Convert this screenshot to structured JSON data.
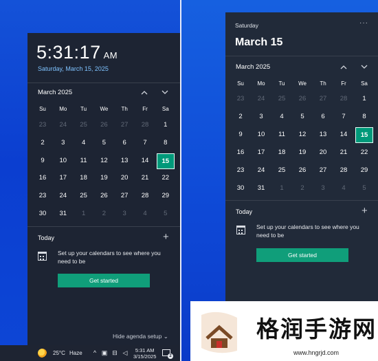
{
  "left_panel": {
    "time": "5:31:17",
    "ampm": "AM",
    "long_date": "Saturday, March 15, 2025",
    "month_label": "March 2025",
    "weekdays": [
      "Su",
      "Mo",
      "Tu",
      "We",
      "Th",
      "Fr",
      "Sa"
    ],
    "weeks": [
      [
        "23",
        "24",
        "25",
        "26",
        "27",
        "28",
        "1"
      ],
      [
        "2",
        "3",
        "4",
        "5",
        "6",
        "7",
        "8"
      ],
      [
        "9",
        "10",
        "11",
        "12",
        "13",
        "14",
        "15"
      ],
      [
        "16",
        "17",
        "18",
        "19",
        "20",
        "21",
        "22"
      ],
      [
        "23",
        "24",
        "25",
        "26",
        "27",
        "28",
        "29"
      ],
      [
        "30",
        "31",
        "1",
        "2",
        "3",
        "4",
        "5"
      ]
    ],
    "agenda_title": "Today",
    "agenda_message": "Set up your calendars to see where you need to be",
    "cta_label": "Get started",
    "hide_agenda_label": "Hide agenda setup"
  },
  "taskbar": {
    "temperature": "25°C",
    "weather": "Haze",
    "time": "5:31 AM",
    "date": "3/15/2025",
    "notification_count": "2"
  },
  "right_panel": {
    "weekday": "Saturday",
    "more": "···",
    "big_date": "March 15",
    "month_label": "March 2025",
    "weekdays": [
      "Su",
      "Mo",
      "Tu",
      "We",
      "Th",
      "Fr",
      "Sa"
    ],
    "weeks": [
      [
        "23",
        "24",
        "25",
        "26",
        "27",
        "28",
        "1"
      ],
      [
        "2",
        "3",
        "4",
        "5",
        "6",
        "7",
        "8"
      ],
      [
        "9",
        "10",
        "11",
        "12",
        "13",
        "14",
        "15"
      ],
      [
        "16",
        "17",
        "18",
        "19",
        "20",
        "21",
        "22"
      ],
      [
        "23",
        "24",
        "25",
        "26",
        "27",
        "28",
        "29"
      ],
      [
        "30",
        "31",
        "1",
        "2",
        "3",
        "4",
        "5"
      ]
    ],
    "agenda_title": "Today",
    "agenda_message": "Set up your calendars to see where you need to be",
    "cta_label": "Get started"
  },
  "watermark": {
    "name": "格润手游网",
    "url": "www.hngrjd.com"
  },
  "colors": {
    "panel_bg": "#1d2433",
    "accent": "#109e7a",
    "today_fill": "#00997a",
    "desktop": "#0b3ed0"
  }
}
